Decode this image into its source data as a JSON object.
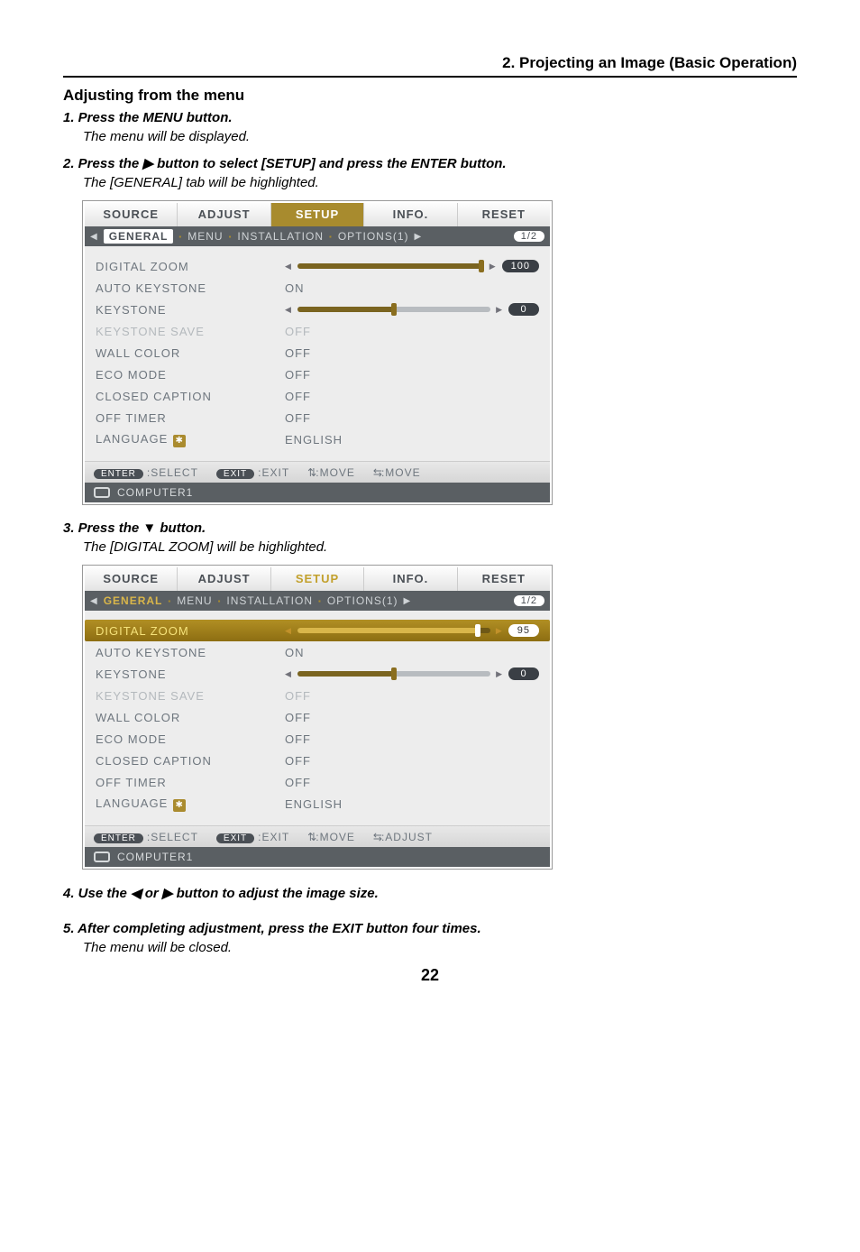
{
  "header": {
    "section": "2. Projecting an Image (Basic Operation)"
  },
  "heading": "Adjusting from the menu",
  "steps": {
    "s1": {
      "title": "1.  Press the MENU button.",
      "note": "The menu will be displayed."
    },
    "s2": {
      "title": "2.  Press the ▶ button to select [SETUP] and press the ENTER button.",
      "note": "The [GENERAL] tab will be highlighted."
    },
    "s3": {
      "title": "3.  Press the ▼ button.",
      "note": "The [DIGITAL ZOOM] will be highlighted."
    },
    "s4": {
      "title": "4.  Use the ◀ or ▶ button to adjust the image size."
    },
    "s5": {
      "title": "5.  After completing adjustment, press the EXIT button four times.",
      "note": "The menu will be closed."
    }
  },
  "osd_common": {
    "topbar": {
      "source": "SOURCE",
      "adjust": "ADJUST",
      "setup": "SETUP",
      "info": "INFO.",
      "reset": "RESET"
    },
    "subbar": {
      "general": "GENERAL",
      "menu": "MENU",
      "installation": "INSTALLATION",
      "options": "OPTIONS(1)",
      "page": "1/2"
    },
    "rows": {
      "digital_zoom": "DIGITAL ZOOM",
      "auto_keystone": "AUTO KEYSTONE",
      "keystone": "KEYSTONE",
      "keystone_save": "KEYSTONE SAVE",
      "wall_color": "WALL COLOR",
      "eco_mode": "ECO MODE",
      "closed_caption": "CLOSED CAPTION",
      "off_timer": "OFF TIMER",
      "language": "LANGUAGE"
    },
    "values": {
      "on": "ON",
      "off": "OFF",
      "english": "ENGLISH"
    },
    "footer": {
      "enter": "ENTER",
      "select": ":SELECT",
      "exit": "EXIT",
      "exitlbl": ":EXIT",
      "move_v": ":MOVE",
      "move_h": ":MOVE",
      "adjust": ":ADJUST",
      "source": "COMPUTER1"
    }
  },
  "osd1": {
    "zoom_value": "100",
    "keystone_value": "0",
    "zoom_fill_pct": 100,
    "keystone_fill_pct": 50
  },
  "osd2": {
    "zoom_value": "95",
    "keystone_value": "0",
    "zoom_fill_pct": 95,
    "keystone_fill_pct": 50
  },
  "page_number": "22",
  "chart_data": {
    "type": "table",
    "screenshots": [
      {
        "state": "GENERAL tab highlighted",
        "rows": [
          {
            "label": "DIGITAL ZOOM",
            "value": 100
          },
          {
            "label": "AUTO KEYSTONE",
            "value": "ON"
          },
          {
            "label": "KEYSTONE",
            "value": 0
          },
          {
            "label": "KEYSTONE SAVE",
            "value": "OFF"
          },
          {
            "label": "WALL COLOR",
            "value": "OFF"
          },
          {
            "label": "ECO MODE",
            "value": "OFF"
          },
          {
            "label": "CLOSED CAPTION",
            "value": "OFF"
          },
          {
            "label": "OFF TIMER",
            "value": "OFF"
          },
          {
            "label": "LANGUAGE",
            "value": "ENGLISH"
          }
        ]
      },
      {
        "state": "DIGITAL ZOOM row highlighted",
        "rows": [
          {
            "label": "DIGITAL ZOOM",
            "value": 95
          },
          {
            "label": "AUTO KEYSTONE",
            "value": "ON"
          },
          {
            "label": "KEYSTONE",
            "value": 0
          },
          {
            "label": "KEYSTONE SAVE",
            "value": "OFF"
          },
          {
            "label": "WALL COLOR",
            "value": "OFF"
          },
          {
            "label": "ECO MODE",
            "value": "OFF"
          },
          {
            "label": "CLOSED CAPTION",
            "value": "OFF"
          },
          {
            "label": "OFF TIMER",
            "value": "OFF"
          },
          {
            "label": "LANGUAGE",
            "value": "ENGLISH"
          }
        ]
      }
    ]
  }
}
